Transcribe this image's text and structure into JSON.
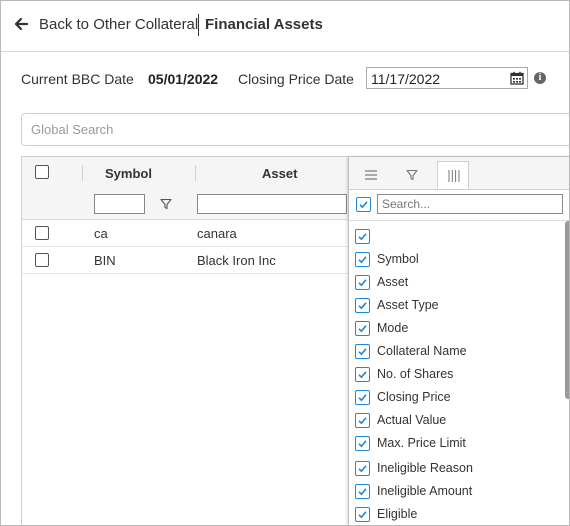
{
  "header": {
    "back_label": "Back to Other Collateral",
    "title": "Financial Assets"
  },
  "dates": {
    "current_bbc_label": "Current BBC Date",
    "current_bbc_value": "05/01/2022",
    "closing_price_label": "Closing Price Date",
    "closing_price_value": "11/17/2022"
  },
  "search": {
    "placeholder": "Global Search"
  },
  "grid": {
    "columns": [
      "Symbol",
      "Asset"
    ],
    "rows": [
      {
        "symbol": "ca",
        "asset": "canara"
      },
      {
        "symbol": "BIN",
        "asset": "Black Iron Inc"
      }
    ]
  },
  "column_menu": {
    "search_placeholder": "Search...",
    "items": [
      "",
      "Symbol",
      "Asset",
      "Asset Type",
      "Mode",
      "Collateral Name",
      "No. of Shares",
      "Closing Price",
      "Actual Value",
      "Max. Price Limit",
      "Ineligible Reason",
      "Ineligible Amount",
      "Eligible"
    ]
  },
  "colors": {
    "accent": "#1e88d8",
    "border": "#cfcfcf",
    "header_bg": "#f5f5f5"
  },
  "icons": [
    "arrow-left-icon",
    "calendar-icon",
    "info-icon",
    "funnel-icon",
    "menu-lines-icon",
    "columns-icon",
    "check-icon"
  ]
}
